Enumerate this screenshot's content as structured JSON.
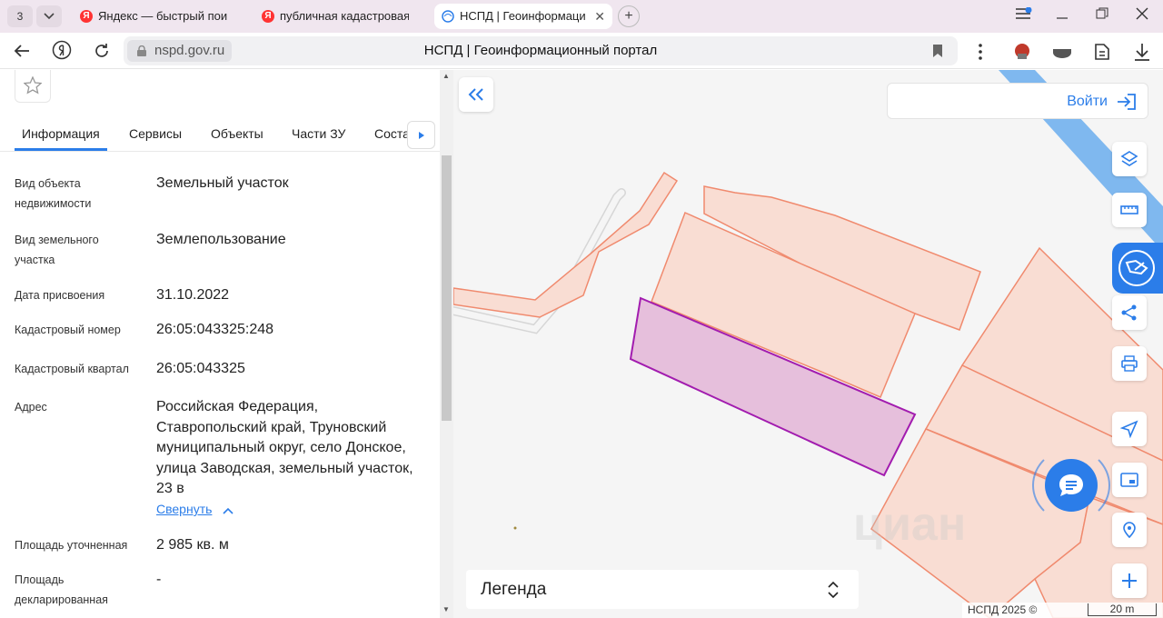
{
  "browser": {
    "tab_count": "3",
    "tabs": [
      {
        "label": "Яндекс — быстрый поиск",
        "favicon": "Я"
      },
      {
        "label": "публичная кадастровая к",
        "favicon": "Я"
      },
      {
        "label": "НСПД | Геоинформаци",
        "favicon": "globe"
      }
    ],
    "url_host": "nspd.gov.ru",
    "page_title": "НСПД | Геоинформационный портал"
  },
  "panel": {
    "tabs": [
      "Информация",
      "Сервисы",
      "Объекты",
      "Части ЗУ",
      "Соста"
    ],
    "rows": [
      {
        "label": "Вид объекта недвижимости",
        "value": "Земельный участок"
      },
      {
        "label": "Вид земельного участка",
        "value": "Землепользование"
      },
      {
        "label": "Дата присвоения",
        "value": "31.10.2022"
      },
      {
        "label": "Кадастровый номер",
        "value": "26:05:043325:248"
      },
      {
        "label": "Кадастровый квартал",
        "value": "26:05:043325"
      },
      {
        "label": "Адрес",
        "value": "Российская Федерация, Ставропольский край, Труновский муниципальный округ, село Донское, улица Заводская, земельный участок, 23 в"
      },
      {
        "label": "Площадь уточненная",
        "value": "2 985 кв. м"
      },
      {
        "label": "Площадь декларированная",
        "value": "-"
      }
    ],
    "collapse_label": "Свернуть"
  },
  "map": {
    "login_label": "Войти",
    "legend_label": "Легенда",
    "footer_copy": "НСПД 2025 ©",
    "scale_label": "20 m",
    "watermark": "циан",
    "colors": {
      "accent": "#2b7de9",
      "parcel_stroke": "#f08a6e",
      "parcel_fill": "#f9ddd3",
      "selected_stroke": "#a21caf",
      "selected_fill": "#e6bfdc"
    }
  }
}
